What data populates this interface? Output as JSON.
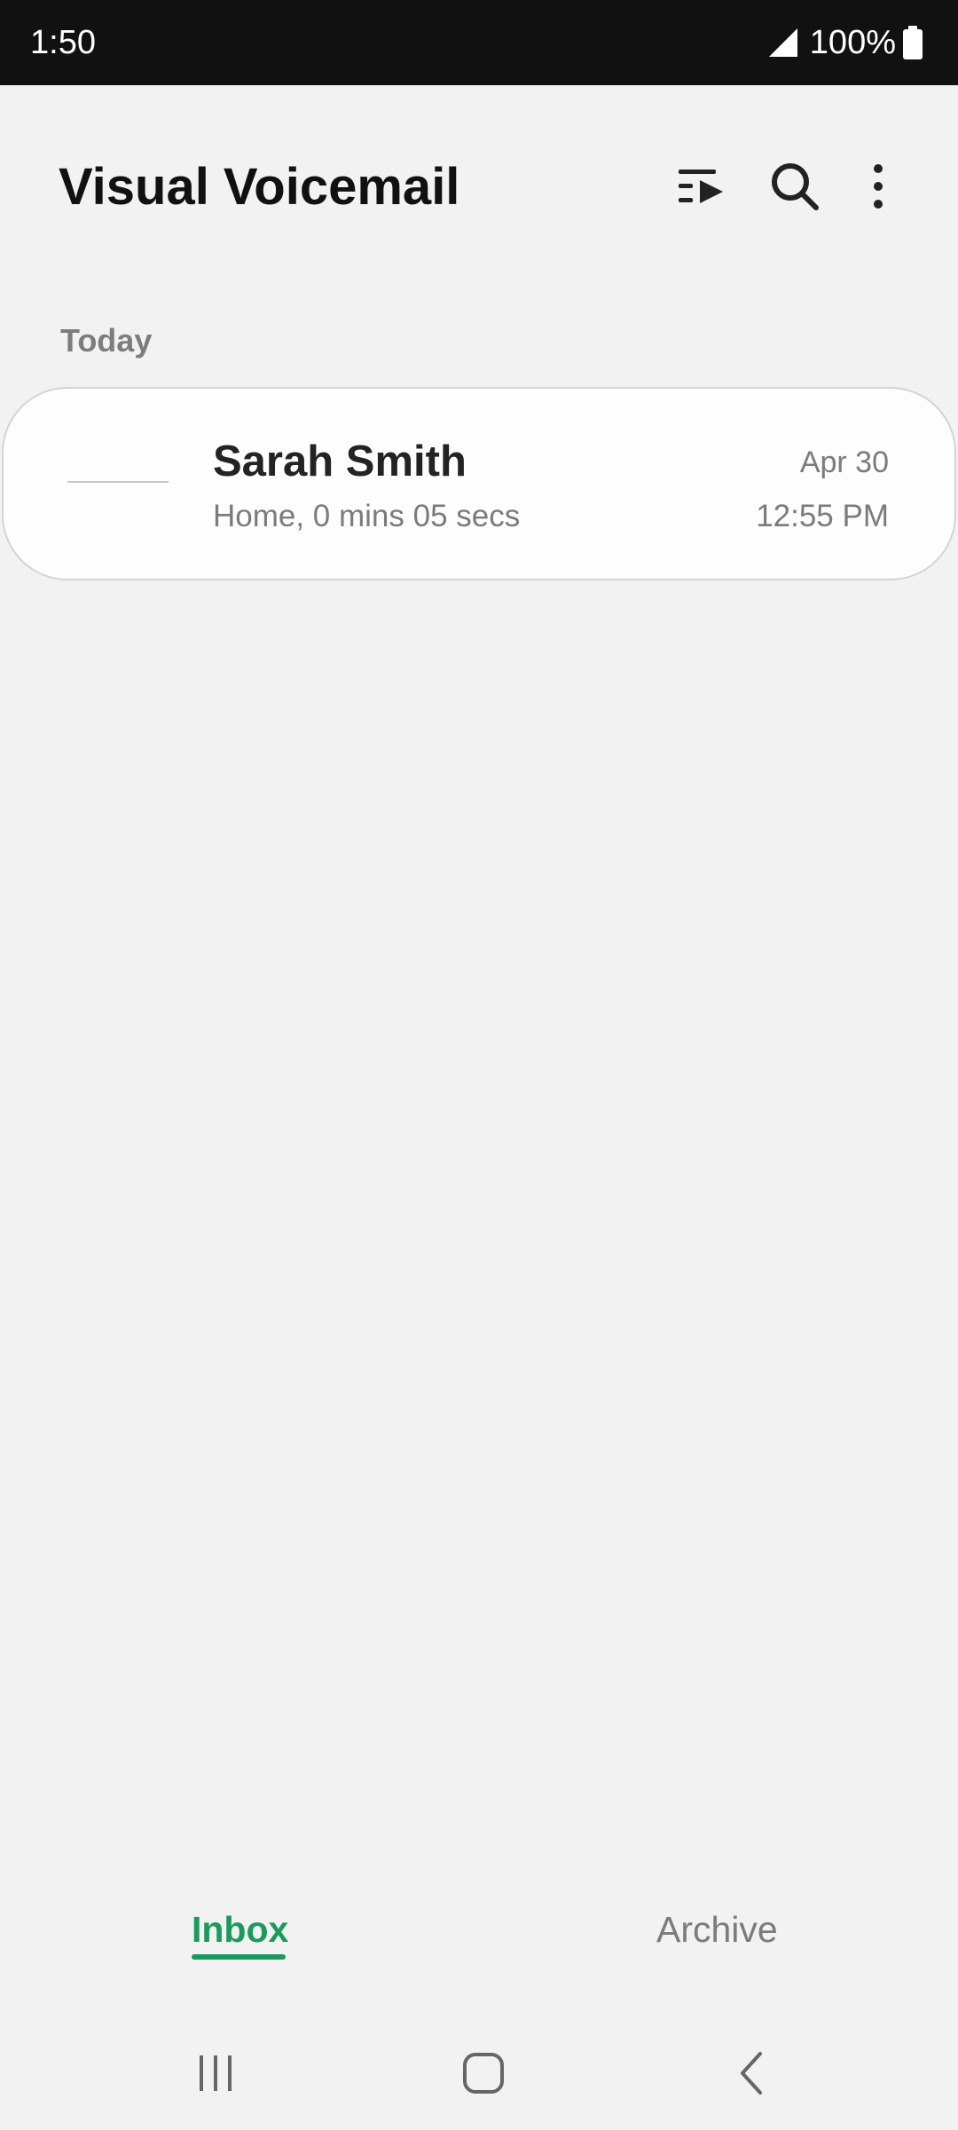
{
  "status_bar": {
    "time": "1:50",
    "battery": "100%",
    "icons": [
      "signal-icon",
      "battery-icon"
    ]
  },
  "header": {
    "title": "Visual Voicemail",
    "actions": [
      {
        "icon": "play-all-icon"
      },
      {
        "icon": "search-icon"
      },
      {
        "icon": "more-options-icon"
      }
    ]
  },
  "sections": [
    {
      "header": "Today",
      "items": [
        {
          "name": "Sarah Smith",
          "details": "Home, 0 mins 05 secs",
          "date": "Apr 30",
          "time": "12:55 PM"
        }
      ]
    }
  ],
  "tabs": [
    {
      "label": "Inbox",
      "selected": true
    },
    {
      "label": "Archive",
      "selected": false
    }
  ],
  "nav_bar": {
    "icons": [
      "recent-apps-icon",
      "home-icon",
      "back-icon"
    ]
  },
  "colors": {
    "accent": "#1a9b5c",
    "background": "#f2f2f2",
    "status_bar": "#111111"
  }
}
